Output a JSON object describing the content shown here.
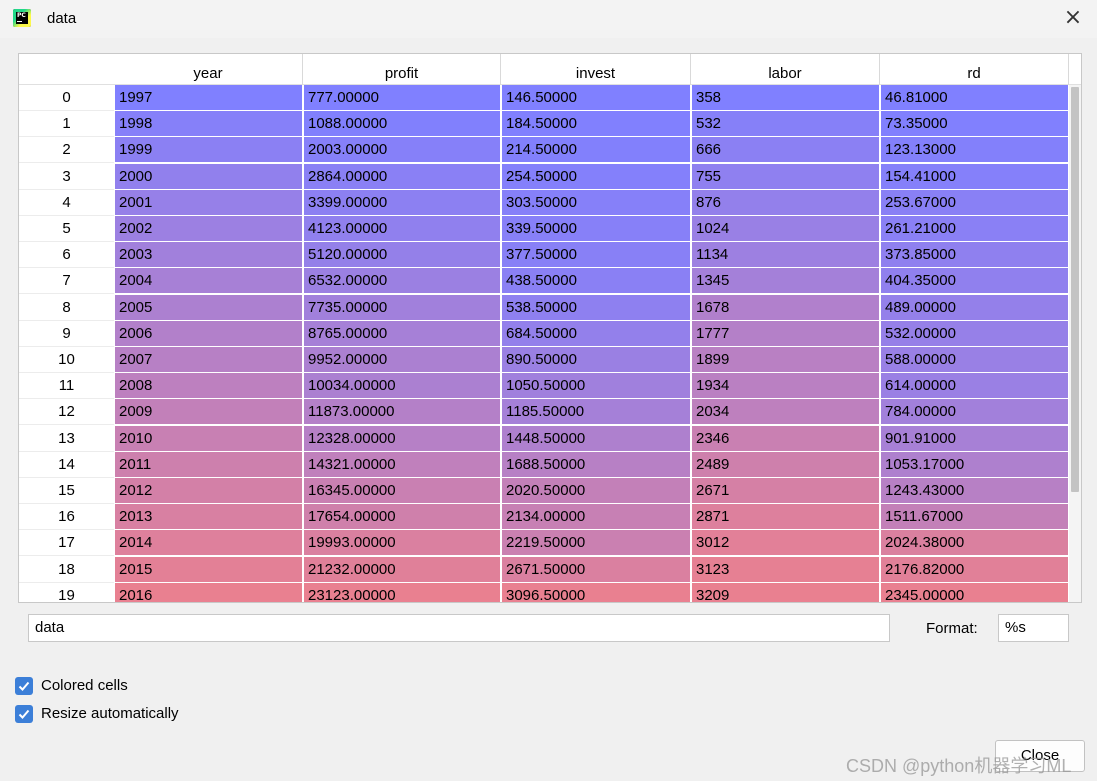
{
  "window": {
    "title": "data",
    "icon": "pycharm-icon",
    "icon_text": "PC"
  },
  "table": {
    "columns": [
      "year",
      "profit",
      "invest",
      "labor",
      "rd"
    ],
    "rows": [
      {
        "index": "0",
        "values": [
          "1997",
          "777.00000",
          "146.50000",
          "358",
          "46.81000"
        ]
      },
      {
        "index": "1",
        "values": [
          "1998",
          "1088.00000",
          "184.50000",
          "532",
          "73.35000"
        ]
      },
      {
        "index": "2",
        "values": [
          "1999",
          "2003.00000",
          "214.50000",
          "666",
          "123.13000"
        ]
      },
      {
        "index": "3",
        "values": [
          "2000",
          "2864.00000",
          "254.50000",
          "755",
          "154.41000"
        ]
      },
      {
        "index": "4",
        "values": [
          "2001",
          "3399.00000",
          "303.50000",
          "876",
          "253.67000"
        ]
      },
      {
        "index": "5",
        "values": [
          "2002",
          "4123.00000",
          "339.50000",
          "1024",
          "261.21000"
        ]
      },
      {
        "index": "6",
        "values": [
          "2003",
          "5120.00000",
          "377.50000",
          "1134",
          "373.85000"
        ]
      },
      {
        "index": "7",
        "values": [
          "2004",
          "6532.00000",
          "438.50000",
          "1345",
          "404.35000"
        ]
      },
      {
        "index": "8",
        "values": [
          "2005",
          "7735.00000",
          "538.50000",
          "1678",
          "489.00000"
        ]
      },
      {
        "index": "9",
        "values": [
          "2006",
          "8765.00000",
          "684.50000",
          "1777",
          "532.00000"
        ]
      },
      {
        "index": "10",
        "values": [
          "2007",
          "9952.00000",
          "890.50000",
          "1899",
          "588.00000"
        ]
      },
      {
        "index": "11",
        "values": [
          "2008",
          "10034.00000",
          "1050.50000",
          "1934",
          "614.00000"
        ]
      },
      {
        "index": "12",
        "values": [
          "2009",
          "11873.00000",
          "1185.50000",
          "2034",
          "784.00000"
        ]
      },
      {
        "index": "13",
        "values": [
          "2010",
          "12328.00000",
          "1448.50000",
          "2346",
          "901.91000"
        ]
      },
      {
        "index": "14",
        "values": [
          "2011",
          "14321.00000",
          "1688.50000",
          "2489",
          "1053.17000"
        ]
      },
      {
        "index": "15",
        "values": [
          "2012",
          "16345.00000",
          "2020.50000",
          "2671",
          "1243.43000"
        ]
      },
      {
        "index": "16",
        "values": [
          "2013",
          "17654.00000",
          "2134.00000",
          "2871",
          "1511.67000"
        ]
      },
      {
        "index": "17",
        "values": [
          "2014",
          "19993.00000",
          "2219.50000",
          "3012",
          "2024.38000"
        ]
      },
      {
        "index": "18",
        "values": [
          "2015",
          "21232.00000",
          "2671.50000",
          "3123",
          "2176.82000"
        ]
      },
      {
        "index": "19",
        "values": [
          "2016",
          "23123.00000",
          "3096.50000",
          "3209",
          "2345.00000"
        ]
      }
    ],
    "cell_colors": {
      "low": "#8080ff",
      "high": "#e98090"
    },
    "column_ranges": [
      [
        1997,
        2016
      ],
      [
        777,
        23123
      ],
      [
        146.5,
        3096.5
      ],
      [
        358,
        3209
      ],
      [
        46.81,
        2345
      ]
    ]
  },
  "name_field": {
    "value": "data"
  },
  "format": {
    "label": "Format:",
    "value": "%s"
  },
  "options": [
    {
      "label": "Colored cells",
      "checked": true
    },
    {
      "label": "Resize automatically",
      "checked": true
    }
  ],
  "close_label": "Close",
  "watermark": "CSDN @python机器学习ML"
}
